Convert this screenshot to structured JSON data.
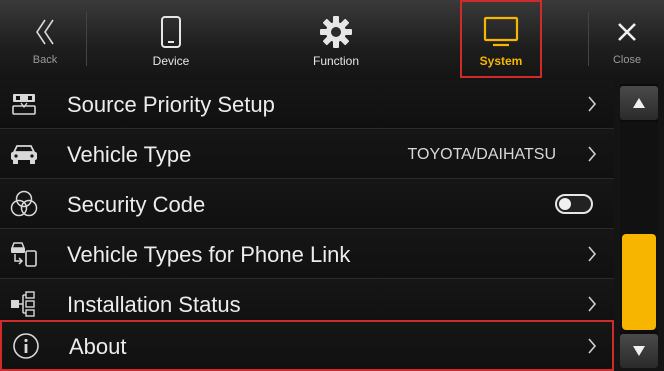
{
  "topbar": {
    "back": {
      "label": "Back",
      "icon": "double-chevron-left-icon"
    },
    "device": {
      "label": "Device",
      "icon": "smartphone-icon"
    },
    "function": {
      "label": "Function",
      "icon": "gear-icon"
    },
    "system": {
      "label": "System",
      "icon": "monitor-icon",
      "selected": true
    },
    "close": {
      "label": "Close",
      "icon": "close-icon"
    }
  },
  "menu": {
    "items": [
      {
        "label": "Source Priority Setup",
        "icon": "source-priority-icon",
        "value": "",
        "control": "chevron"
      },
      {
        "label": "Vehicle Type",
        "icon": "car-icon",
        "value": "TOYOTA/DAIHATSU",
        "control": "chevron"
      },
      {
        "label": "Security Code",
        "icon": "security-code-icon",
        "value": "",
        "control": "toggle",
        "toggle_on": false
      },
      {
        "label": "Vehicle Types for Phone Link",
        "icon": "phone-link-icon",
        "value": "",
        "control": "chevron"
      },
      {
        "label": "Installation Status",
        "icon": "installation-status-icon",
        "value": "",
        "control": "chevron"
      },
      {
        "label": "About",
        "icon": "info-icon",
        "value": "",
        "control": "chevron",
        "highlighted": true
      }
    ]
  },
  "scrollbar": {
    "position": 1.0
  },
  "colors": {
    "accent": "#f7b500",
    "highlight": "#d02a2a",
    "background": "#141414"
  }
}
